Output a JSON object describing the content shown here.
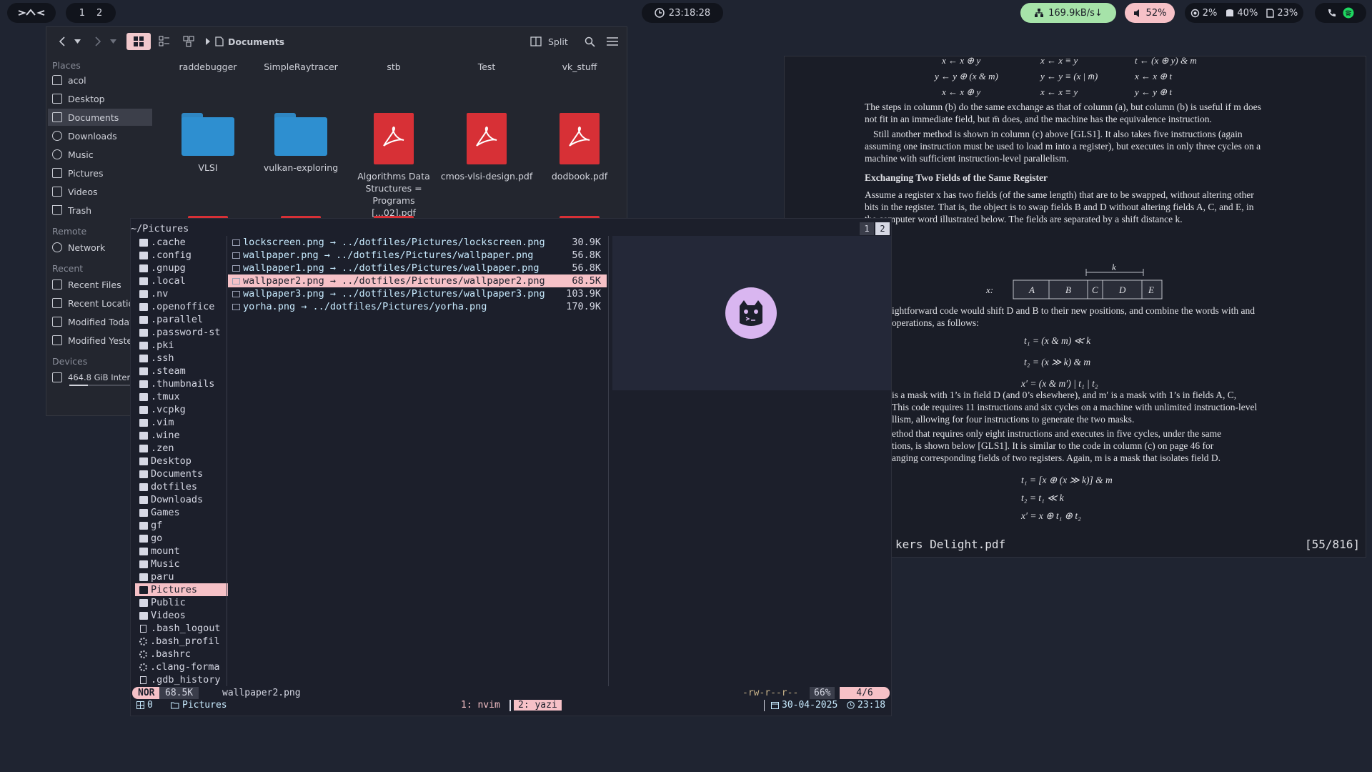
{
  "topbar": {
    "workspaces": [
      "1",
      "2"
    ],
    "clock": "23:18:28",
    "network": "169.9kB/s↓",
    "volume": "52%",
    "cpu": "2%",
    "memory": "40%",
    "disk": "23%"
  },
  "file_manager": {
    "breadcrumb": "Documents",
    "split_label": "Split",
    "sidebar": {
      "places_header": "Places",
      "places": [
        "acol",
        "Desktop",
        "Documents",
        "Downloads",
        "Music",
        "Pictures",
        "Videos",
        "Trash"
      ],
      "remote_header": "Remote",
      "remote": [
        "Network"
      ],
      "recent_header": "Recent",
      "recent": [
        "Recent Files",
        "Recent Locations",
        "Modified Today",
        "Modified Yesterday"
      ],
      "devices_header": "Devices",
      "devices": [
        "464.8 GiB Internal Drive"
      ]
    },
    "top_row_names": [
      "raddebugger",
      "SimpleRaytracer",
      "stb",
      "Test",
      "vk_stuff"
    ],
    "items": [
      {
        "name": "VLSI",
        "kind": "folder"
      },
      {
        "name": "vulkan-exploring",
        "kind": "folder"
      },
      {
        "name": "Algorithms Data Structures = Programs [...02].pdf",
        "kind": "pdf"
      },
      {
        "name": "cmos-vlsi-design.pdf",
        "kind": "pdf"
      },
      {
        "name": "dodbook.pdf",
        "kind": "pdf"
      }
    ]
  },
  "pdf_viewer": {
    "filename": "kers Delight.pdf",
    "page_indicator": "[55/816]",
    "heading": "Exchanging Two Fields of the Same Register"
  },
  "yazi": {
    "cwd": "~/Pictures",
    "tabs": [
      "1",
      "2"
    ],
    "parent_entries": [
      {
        "name": ".cache",
        "type": "dir"
      },
      {
        "name": ".config",
        "type": "dir"
      },
      {
        "name": ".gnupg",
        "type": "dir"
      },
      {
        "name": ".local",
        "type": "dir"
      },
      {
        "name": ".nv",
        "type": "dir"
      },
      {
        "name": ".openoffice",
        "type": "dir"
      },
      {
        "name": ".parallel",
        "type": "dir"
      },
      {
        "name": ".password-st",
        "type": "dir"
      },
      {
        "name": ".pki",
        "type": "dir"
      },
      {
        "name": ".ssh",
        "type": "dir"
      },
      {
        "name": ".steam",
        "type": "dir"
      },
      {
        "name": ".thumbnails",
        "type": "dir"
      },
      {
        "name": ".tmux",
        "type": "dir"
      },
      {
        "name": ".vcpkg",
        "type": "dir"
      },
      {
        "name": ".vim",
        "type": "dir"
      },
      {
        "name": ".wine",
        "type": "dir"
      },
      {
        "name": ".zen",
        "type": "dir"
      },
      {
        "name": "Desktop",
        "type": "dir"
      },
      {
        "name": "Documents",
        "type": "dir"
      },
      {
        "name": "dotfiles",
        "type": "dir"
      },
      {
        "name": "Downloads",
        "type": "dir"
      },
      {
        "name": "Games",
        "type": "dir"
      },
      {
        "name": "gf",
        "type": "dir"
      },
      {
        "name": "go",
        "type": "dir"
      },
      {
        "name": "mount",
        "type": "dir"
      },
      {
        "name": "Music",
        "type": "dir"
      },
      {
        "name": "paru",
        "type": "dir"
      },
      {
        "name": "Pictures",
        "type": "dir",
        "selected": true
      },
      {
        "name": "Public",
        "type": "dir"
      },
      {
        "name": "Videos",
        "type": "dir"
      },
      {
        "name": ".bash_logout",
        "type": "file"
      },
      {
        "name": ".bash_profil",
        "type": "gear"
      },
      {
        "name": ".bashrc",
        "type": "gear"
      },
      {
        "name": ".clang-forma",
        "type": "gear"
      },
      {
        "name": ".gdb_history",
        "type": "file"
      }
    ],
    "current_entries": [
      {
        "name": "lockscreen.png → ../dotfiles/Pictures/lockscreen.png",
        "size": "30.9K"
      },
      {
        "name": "wallpaper.png → ../dotfiles/Pictures/wallpaper.png",
        "size": "56.8K"
      },
      {
        "name": "wallpaper1.png → ../dotfiles/Pictures/wallpaper.png",
        "size": "56.8K"
      },
      {
        "name": "wallpaper2.png → ../dotfiles/Pictures/wallpaper2.png",
        "size": "68.5K",
        "selected": true
      },
      {
        "name": "wallpaper3.png → ../dotfiles/Pictures/wallpaper3.png",
        "size": "103.9K"
      },
      {
        "name": "yorha.png → ../dotfiles/Pictures/yorha.png",
        "size": "170.9K"
      }
    ],
    "status": {
      "mode": "NOR",
      "size": "68.5K",
      "filename": "wallpaper2.png",
      "permissions": "-rw-r--r--",
      "percent": "66%",
      "position": "4/6"
    },
    "tmux": {
      "panes": "0",
      "session": "Pictures",
      "window1": "1: nvim",
      "window2": "2: yazi",
      "date": "30-04-2025",
      "time": "23:18"
    }
  }
}
